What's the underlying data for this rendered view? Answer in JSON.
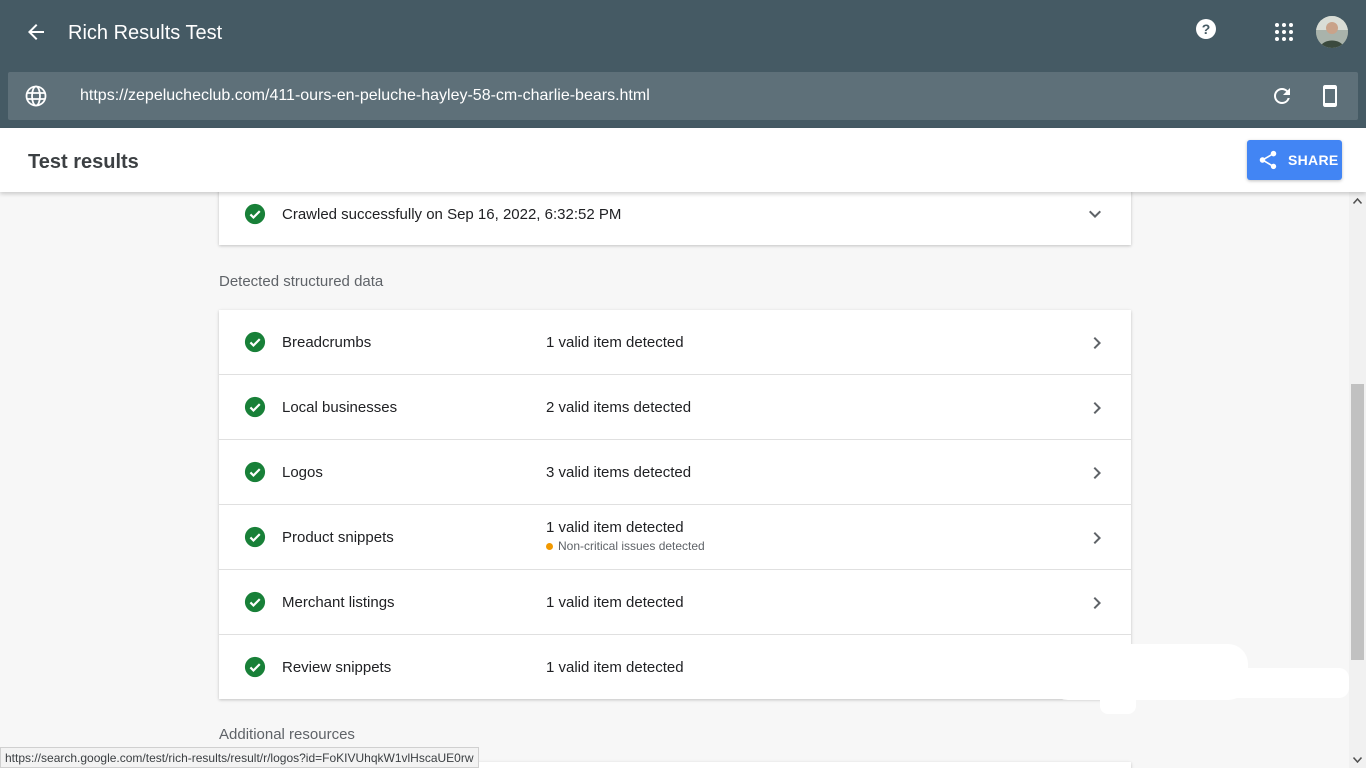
{
  "app": {
    "title": "Rich Results Test",
    "back_icon": "arrow-left-icon",
    "help_icon": "help-icon",
    "apps_icon": "apps-grid-icon"
  },
  "urlbar": {
    "url": "https://zepelucheclub.com/411-ours-en-peluche-hayley-58-cm-charlie-bears.html",
    "globe_icon": "globe-icon",
    "refresh_icon": "refresh-icon",
    "device_icon": "smartphone-icon"
  },
  "results": {
    "title": "Test results",
    "share_label": "SHARE"
  },
  "crawl": {
    "text": "Crawled successfully on Sep 16, 2022, 6:32:52 PM"
  },
  "sections": {
    "detected": "Detected structured data",
    "additional": "Additional resources"
  },
  "items": [
    {
      "name": "Breadcrumbs",
      "status": "1 valid item detected",
      "warning": "",
      "has_chevron": true
    },
    {
      "name": "Local businesses",
      "status": "2 valid items detected",
      "warning": "",
      "has_chevron": true
    },
    {
      "name": "Logos",
      "status": "3 valid items detected",
      "warning": "",
      "has_chevron": true
    },
    {
      "name": "Product snippets",
      "status": "1 valid item detected",
      "warning": "Non-critical issues detected",
      "has_chevron": true
    },
    {
      "name": "Merchant listings",
      "status": "1 valid item detected",
      "warning": "",
      "has_chevron": true
    },
    {
      "name": "Review snippets",
      "status": "1 valid item detected",
      "warning": "",
      "has_chevron": false
    }
  ],
  "status_bar": {
    "url": "https://search.google.com/test/rich-results/result/r/logos?id=FoKIVUhqkW1vlHscaUE0rw"
  },
  "colors": {
    "appbar": "#455a64",
    "urlbar": "#5e7079",
    "accent": "#4285f4",
    "success": "#188038",
    "warning": "#f29900"
  }
}
